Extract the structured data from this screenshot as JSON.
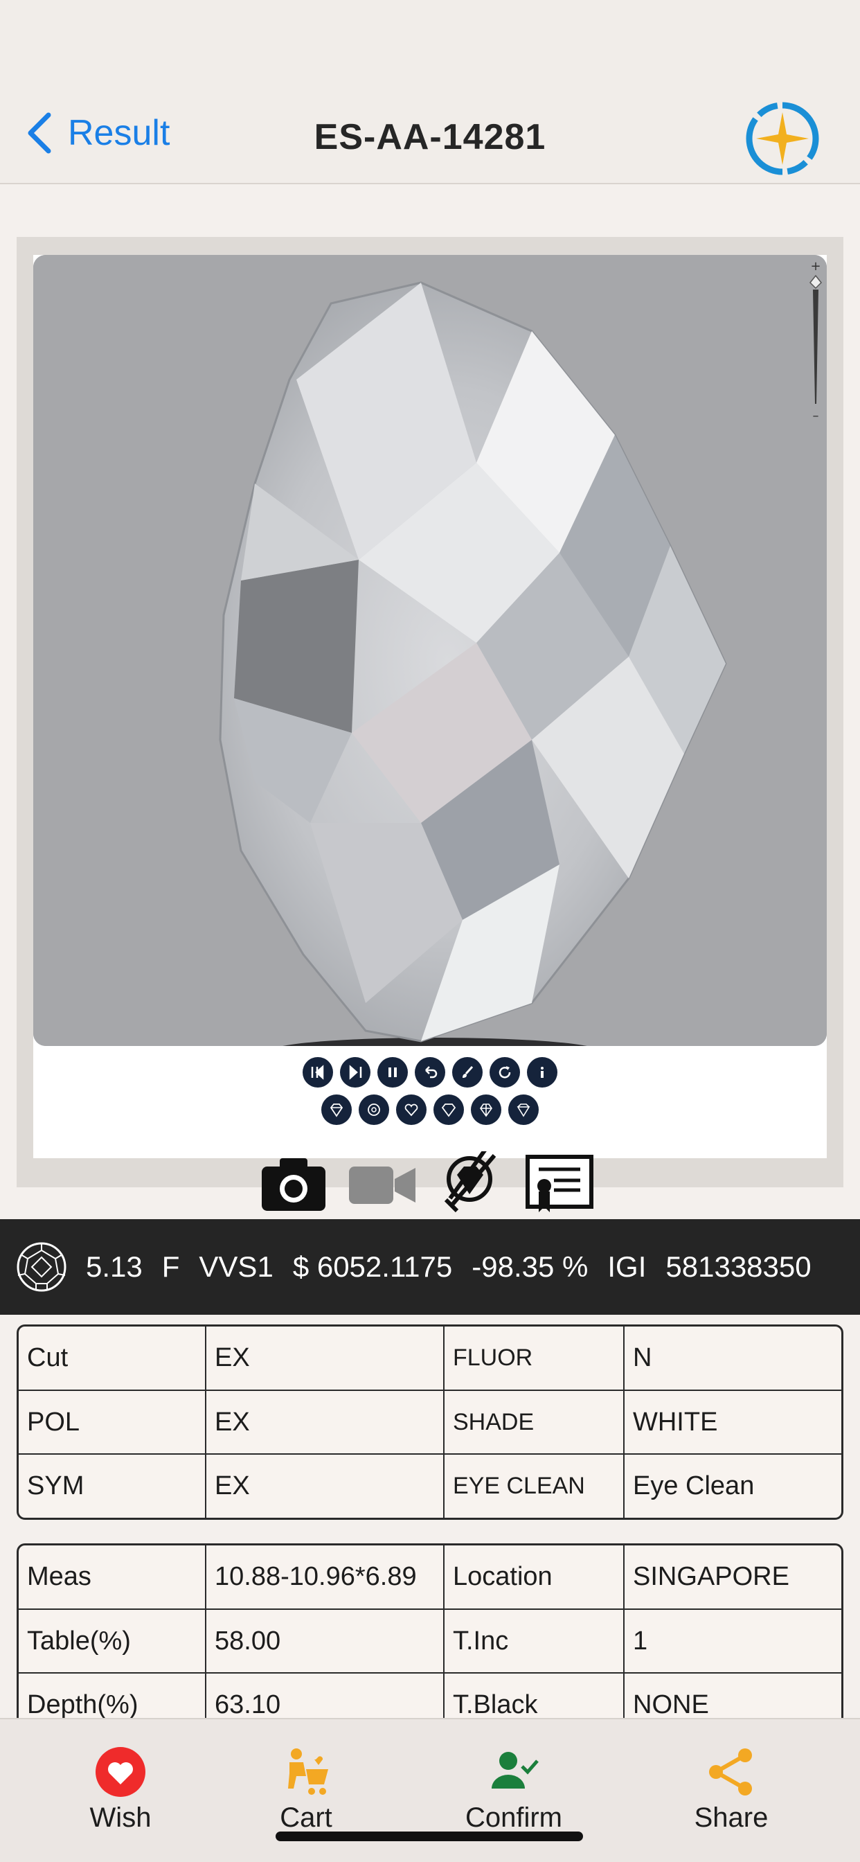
{
  "nav": {
    "back_label": "Result",
    "title": "ES-AA-14281"
  },
  "viewer": {
    "controls_row1": [
      "first-icon",
      "last-icon",
      "pause-icon",
      "undo-icon",
      "brush-icon",
      "rotate-icon",
      "info-icon"
    ],
    "controls_row2": [
      "diamond-top-icon",
      "diamond-bottom-icon",
      "heart-icon",
      "diamond-side-icon",
      "diamond-crown-icon",
      "diamond-pavilion-icon"
    ],
    "media_tabs": [
      "camera-icon",
      "video-icon",
      "loupe-icon",
      "certificate-icon"
    ]
  },
  "summary": {
    "carat": "5.13",
    "color": "F",
    "clarity": "VVS1",
    "price": "$ 6052.1175",
    "discount": "-98.35 %",
    "lab": "IGI",
    "report_no": "581338350"
  },
  "grade_table": {
    "rows": [
      [
        "Cut",
        "EX",
        "FLUOR",
        "N"
      ],
      [
        "POL",
        "EX",
        "SHADE",
        "WHITE"
      ],
      [
        "SYM",
        "EX",
        "EYE CLEAN",
        "Eye Clean"
      ]
    ]
  },
  "measure_table": {
    "rows": [
      [
        "Meas",
        "10.88-10.96*6.89",
        "Location",
        "SINGAPORE"
      ],
      [
        "Table(%)",
        "58.00",
        "T.Inc",
        "1"
      ],
      [
        "Depth(%)",
        "63.10",
        "T.Black",
        "NONE"
      ]
    ]
  },
  "bottom_tabs": [
    {
      "label": "Wish",
      "icon": "heart-icon",
      "color": "#ef2b2b"
    },
    {
      "label": "Cart",
      "icon": "cart-icon",
      "color": "#f3a823"
    },
    {
      "label": "Confirm",
      "icon": "user-check-icon",
      "color": "#1b7f3c"
    },
    {
      "label": "Share",
      "icon": "share-icon",
      "color": "#f3a823"
    }
  ],
  "colors": {
    "accent_blue": "#1a7fe6",
    "summary_bg": "#252525",
    "logo_blue": "#1a8fd6",
    "logo_gold": "#f2b01e"
  }
}
